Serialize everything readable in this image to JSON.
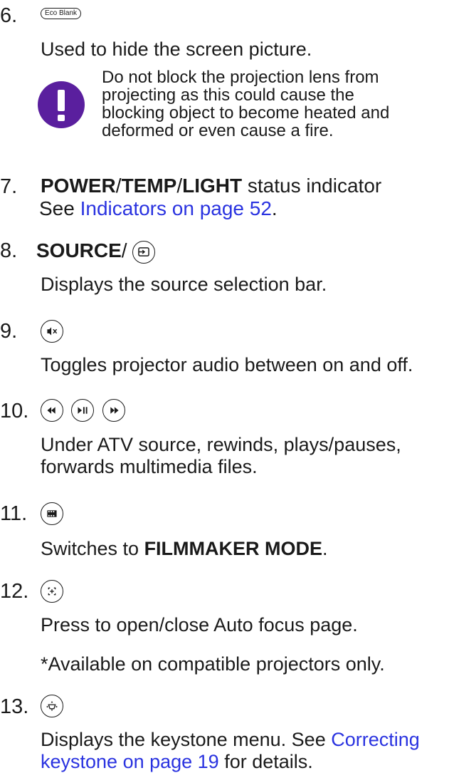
{
  "items": [
    {
      "num": "6.",
      "key_label": "Eco Blank",
      "desc": "Used to hide the screen picture."
    },
    {
      "num": "7.",
      "bold1": "POWER",
      "sep1": "/",
      "bold2": "TEMP",
      "sep2": "/",
      "bold3": "LIGHT",
      "rest": " status indicator",
      "see": "See ",
      "link": "Indicators on page 52",
      "end": "."
    },
    {
      "num": "8.",
      "bold": "SOURCE",
      "slash": "/",
      "desc": "Displays the source selection bar."
    },
    {
      "num": "9.",
      "desc": "Toggles projector audio between on and off."
    },
    {
      "num": "10.",
      "desc_line1": "Under ATV source, rewinds, plays/pauses,",
      "desc_line2": "forwards multimedia files."
    },
    {
      "num": "11.",
      "pre": "Switches to ",
      "bold": "FILMMAKER MODE",
      "end": "."
    },
    {
      "num": "12.",
      "desc": "Press to open/close Auto focus page.",
      "note": "*Available on compatible projectors only."
    },
    {
      "num": "13.",
      "desc_pre": "Displays the keystone menu. See ",
      "link_a": "Correcting",
      "link_b": "keystone on page 19",
      "desc_post": " for details."
    }
  ],
  "warning": {
    "line1": "Do not block the projection lens from",
    "line2": "projecting as this could cause the",
    "line3": "blocking object to become heated and",
    "line4": "deformed or even cause a fire.",
    "icon_color": "#5a1f9e"
  },
  "icons": [
    "eco-blank-key",
    "warning-icon",
    "source-icon",
    "mute-icon",
    "rewind-icon",
    "play-pause-icon",
    "forward-icon",
    "filmmaker-icon",
    "auto-focus-icon",
    "keystone-icon"
  ]
}
